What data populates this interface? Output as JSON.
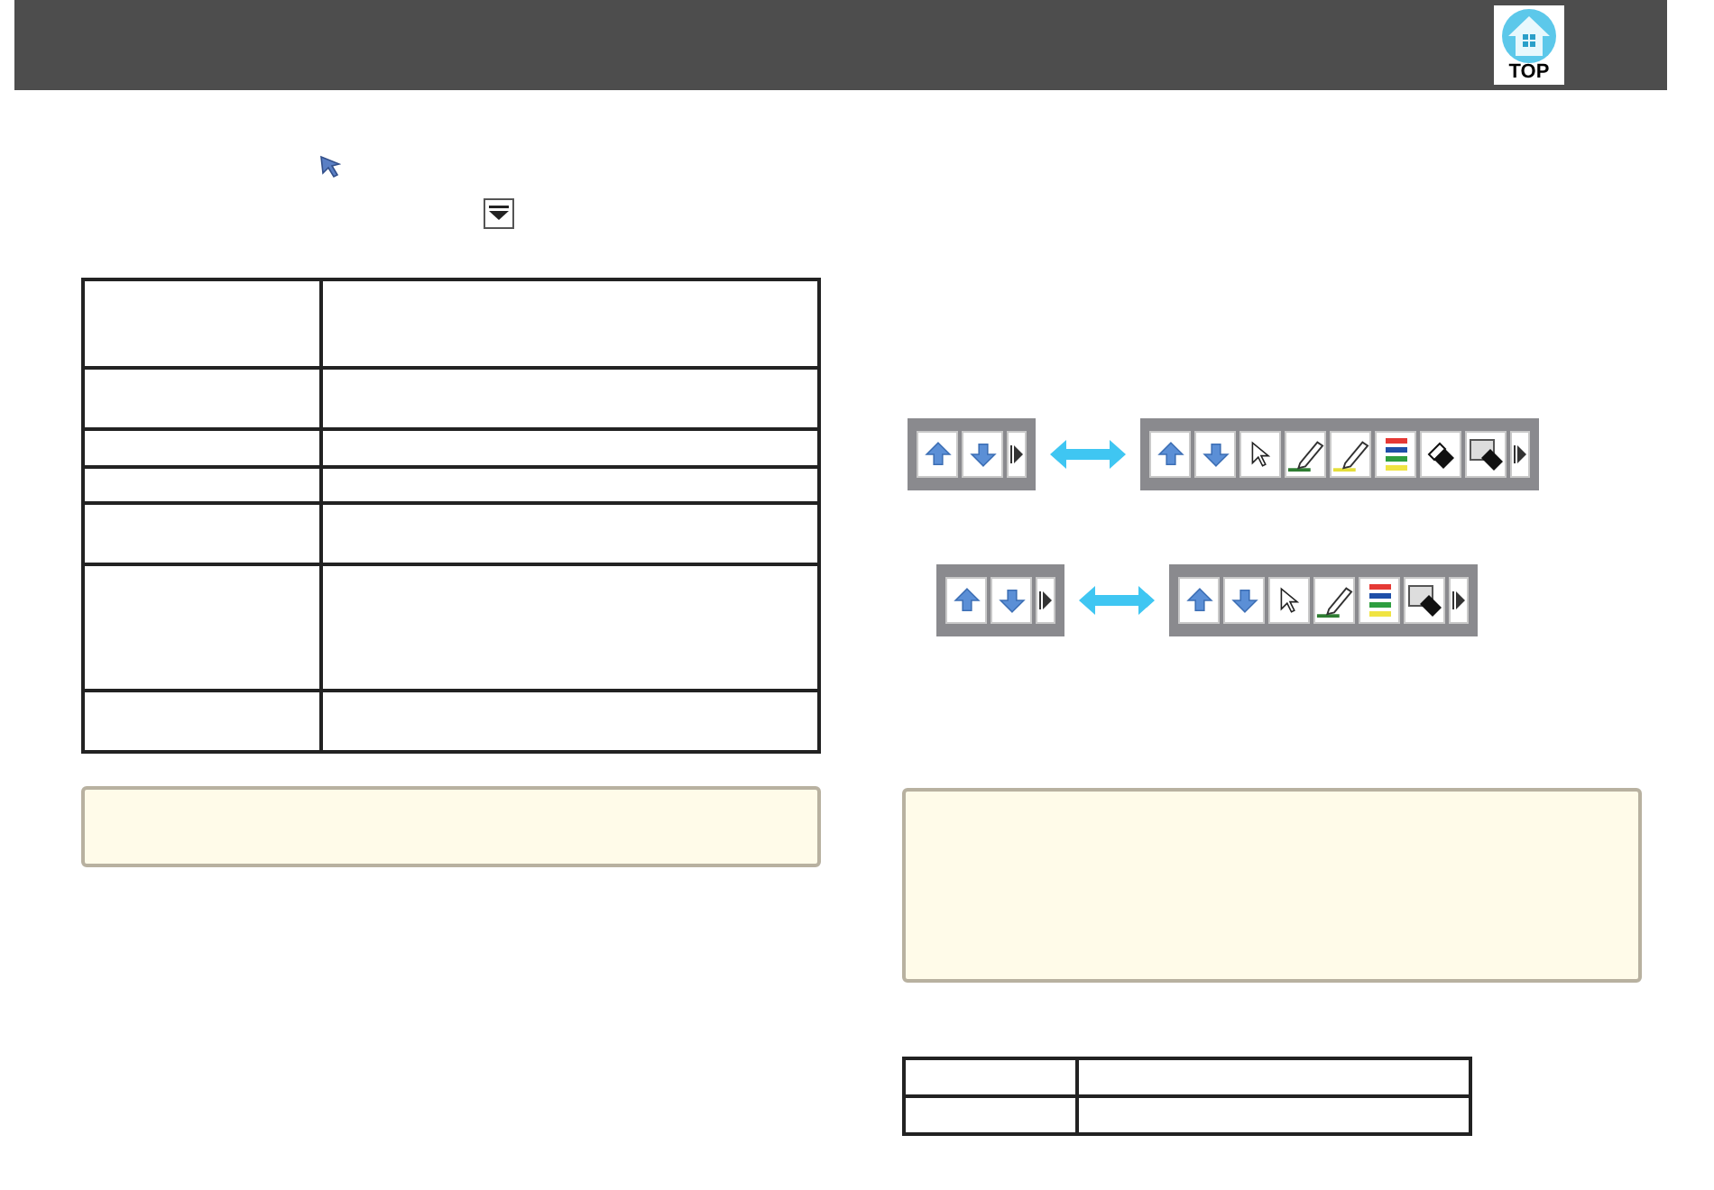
{
  "header": {
    "top_button": "TOP"
  },
  "toolbar_pairs": [
    {
      "collapsed": [
        {
          "kind": "up"
        },
        {
          "kind": "down"
        },
        {
          "kind": "expand"
        }
      ],
      "expanded": [
        {
          "kind": "up"
        },
        {
          "kind": "down"
        },
        {
          "kind": "pointer"
        },
        {
          "kind": "pen"
        },
        {
          "kind": "highlighter"
        },
        {
          "kind": "colors"
        },
        {
          "kind": "eraser"
        },
        {
          "kind": "clear"
        },
        {
          "kind": "expand"
        }
      ]
    },
    {
      "collapsed": [
        {
          "kind": "up"
        },
        {
          "kind": "down"
        },
        {
          "kind": "expand"
        }
      ],
      "expanded": [
        {
          "kind": "up"
        },
        {
          "kind": "down"
        },
        {
          "kind": "pointer"
        },
        {
          "kind": "pen"
        },
        {
          "kind": "colors"
        },
        {
          "kind": "clear"
        },
        {
          "kind": "expand"
        }
      ]
    }
  ]
}
